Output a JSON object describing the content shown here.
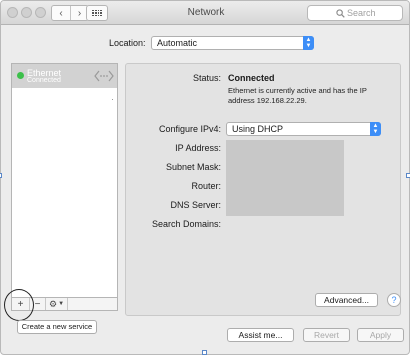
{
  "window": {
    "title": "Network"
  },
  "search": {
    "placeholder": "Search"
  },
  "location": {
    "label": "Location:",
    "value": "Automatic"
  },
  "services": {
    "items": [
      {
        "name": "Ethernet",
        "status": "Connected",
        "status_color": "#3cc04a"
      }
    ],
    "add_label": "+",
    "remove_label": "−",
    "action_icon": "gear-icon",
    "create_label": "Create a new service"
  },
  "detail": {
    "status_label": "Status:",
    "status_value": "Connected",
    "status_description": "Ethernet is currently active and has the IP address 192.168.22.29.",
    "configure_label": "Configure IPv4:",
    "configure_value": "Using DHCP",
    "ip_label": "IP Address:",
    "subnet_label": "Subnet Mask:",
    "router_label": "Router:",
    "dns_label": "DNS Server:",
    "domains_label": "Search Domains:",
    "advanced_label": "Advanced...",
    "help_label": "?"
  },
  "footer": {
    "assist_label": "Assist me...",
    "revert_label": "Revert",
    "apply_label": "Apply"
  },
  "colors": {
    "accent": "#3d8ef7",
    "connected": "#3cc04a",
    "selection": "#d2d2d2"
  }
}
